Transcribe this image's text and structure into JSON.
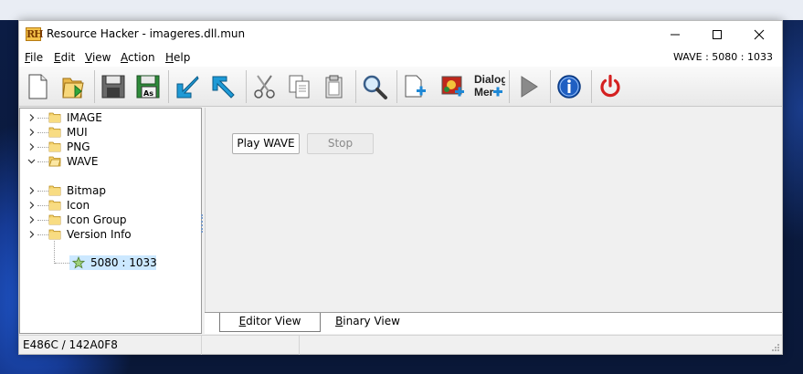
{
  "window": {
    "title": "Resource Hacker - imageres.dll.mun",
    "app_icon_text": "RH",
    "controls": {
      "minimize": "minimize-icon",
      "maximize": "maximize-icon",
      "close": "close-icon"
    }
  },
  "menubar": {
    "items": [
      {
        "label": "File",
        "underline": "F",
        "rest": "ile"
      },
      {
        "label": "Edit",
        "underline": "E",
        "rest": "dit"
      },
      {
        "label": "View",
        "underline": "V",
        "rest": "iew"
      },
      {
        "label": "Action",
        "underline": "A",
        "rest": "ction"
      },
      {
        "label": "Help",
        "underline": "H",
        "rest": "elp"
      }
    ],
    "resource_indicator": "WAVE : 5080 : 1033"
  },
  "toolbar": {
    "buttons": [
      {
        "name": "new-file",
        "icon": "new-document-icon"
      },
      {
        "name": "open-file",
        "icon": "open-folder-icon"
      },
      {
        "name": "save",
        "icon": "save-icon"
      },
      {
        "name": "save-as",
        "icon": "save-as-icon",
        "badge": "As"
      },
      {
        "name": "compile",
        "icon": "arrow-down-left-icon"
      },
      {
        "name": "go-back",
        "icon": "arrow-up-left-icon"
      },
      {
        "name": "cut",
        "icon": "scissors-icon"
      },
      {
        "name": "copy",
        "icon": "copy-icon"
      },
      {
        "name": "paste",
        "icon": "clipboard-icon"
      },
      {
        "name": "find",
        "icon": "magnifier-icon"
      },
      {
        "name": "add-blank-resource",
        "icon": "add-blank-icon"
      },
      {
        "name": "add-image-resource",
        "icon": "add-image-icon"
      },
      {
        "name": "dialog-merger",
        "icon": "dialog-merger-icon",
        "label": "Dialog Mer"
      },
      {
        "name": "play",
        "icon": "play-icon"
      },
      {
        "name": "about",
        "icon": "info-icon"
      },
      {
        "name": "exit",
        "icon": "power-icon"
      }
    ]
  },
  "tree": {
    "items": [
      {
        "label": "IMAGE",
        "expanded": false
      },
      {
        "label": "MUI",
        "expanded": false
      },
      {
        "label": "PNG",
        "expanded": false
      },
      {
        "label": "WAVE",
        "expanded": true,
        "children": [
          {
            "label": "5080 : 1033",
            "selected": true
          }
        ]
      },
      {
        "label": "Bitmap",
        "expanded": false
      },
      {
        "label": "Icon",
        "expanded": false
      },
      {
        "label": "Icon Group",
        "expanded": false
      },
      {
        "label": "Version Info",
        "expanded": false
      }
    ]
  },
  "editor": {
    "play_label": "Play WAVE",
    "stop_label": "Stop",
    "stop_enabled": false
  },
  "tabs": [
    {
      "label": "Editor View",
      "underline": "E",
      "rest": "ditor View",
      "active": true
    },
    {
      "label": "Binary View",
      "underline": "B",
      "rest": "inary View",
      "active": false
    }
  ],
  "statusbar": {
    "offset_text": "E486C / 142A0F8",
    "cell2": "",
    "cell3": ""
  },
  "colors": {
    "selection": "#cce8ff",
    "folder_yellow": "#f5d26b",
    "arrow_blue": "#1e9ad6",
    "power_red": "#d42020",
    "info_blue": "#1f5fc2"
  }
}
